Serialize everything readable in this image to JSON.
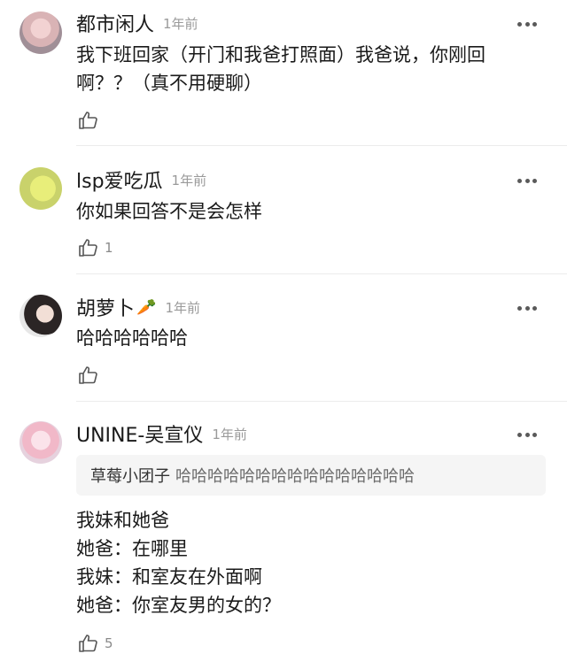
{
  "comments": [
    {
      "name": "都市闲人",
      "time": "1年前",
      "lines": [
        "我下班回家（开门和我爸打照面）我爸说，你刚回",
        "啊？？（真不用硬聊）"
      ],
      "likes": ""
    },
    {
      "name": "lsp爱吃瓜",
      "time": "1年前",
      "lines": [
        "你如果回答不是会怎样"
      ],
      "likes": "1"
    },
    {
      "name": "胡萝卜",
      "emoji": "🥕",
      "time": "1年前",
      "lines": [
        "哈哈哈哈哈哈"
      ],
      "likes": ""
    },
    {
      "name": "UNINE-吴宣仪",
      "time": "1年前",
      "quote": {
        "name": "草莓小团子",
        "text": "哈哈哈哈哈哈哈哈哈哈哈哈哈哈哈"
      },
      "lines": [
        "我妹和她爸",
        "她爸：在哪里",
        "我妹：和室友在外面啊",
        "她爸：你室友男的女的？"
      ],
      "likes": "5"
    }
  ],
  "icons": {
    "more": "more-horizontal-icon",
    "like": "thumbs-up-icon"
  },
  "colors": {
    "name": "#1a1a1a",
    "meta": "#9a9a9a",
    "quote_bg": "#f5f5f5",
    "divider": "#ececec"
  }
}
